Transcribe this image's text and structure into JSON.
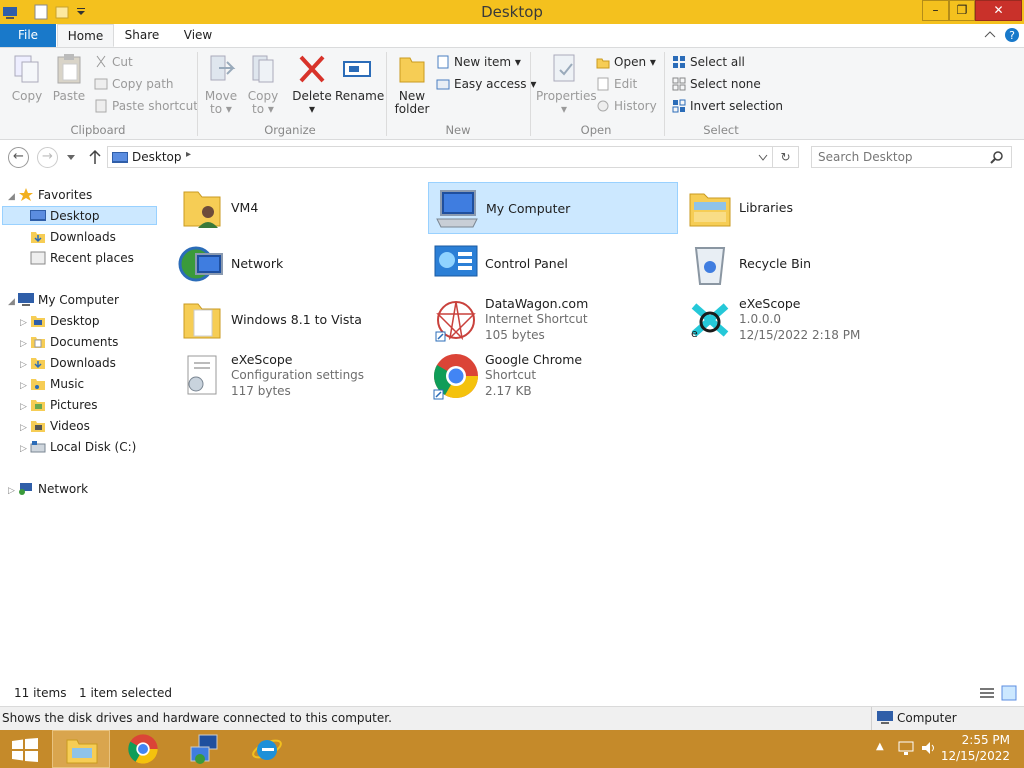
{
  "window": {
    "title": "Desktop"
  },
  "tabs": {
    "file": "File",
    "home": "Home",
    "share": "Share",
    "view": "View"
  },
  "ribbon": {
    "clipboard": {
      "label": "Clipboard",
      "copy": "Copy",
      "paste": "Paste",
      "cut": "Cut",
      "copy_path": "Copy path",
      "paste_shortcut": "Paste shortcut"
    },
    "organize": {
      "label": "Organize",
      "move_to_1": "Move",
      "move_to_2": "to",
      "copy_to_1": "Copy",
      "copy_to_2": "to",
      "delete": "Delete",
      "rename": "Rename"
    },
    "new": {
      "label": "New",
      "new_folder_1": "New",
      "new_folder_2": "folder",
      "new_item": "New item",
      "easy_access": "Easy access"
    },
    "open": {
      "label": "Open",
      "properties": "Properties",
      "open": "Open",
      "edit": "Edit",
      "history": "History"
    },
    "select": {
      "label": "Select",
      "select_all": "Select all",
      "select_none": "Select none",
      "invert_selection": "Invert selection"
    }
  },
  "address": {
    "path": "Desktop",
    "search_placeholder": "Search Desktop"
  },
  "navpane": {
    "favorites": "Favorites",
    "fav_items": [
      "Desktop",
      "Downloads",
      "Recent places"
    ],
    "my_computer": "My Computer",
    "pc_items": [
      "Desktop",
      "Documents",
      "Downloads",
      "Music",
      "Pictures",
      "Videos",
      "Local Disk (C:)"
    ],
    "network": "Network"
  },
  "items": {
    "vm4": {
      "name": "VM4"
    },
    "my_computer": {
      "name": "My Computer"
    },
    "libraries": {
      "name": "Libraries"
    },
    "network": {
      "name": "Network"
    },
    "control_panel": {
      "name": "Control Panel"
    },
    "recycle_bin": {
      "name": "Recycle Bin"
    },
    "win81": {
      "name": "Windows 8.1 to Vista"
    },
    "datawagon": {
      "name": "DataWagon.com",
      "type": "Internet Shortcut",
      "size": "105 bytes"
    },
    "exescope_app": {
      "name": "eXeScope",
      "version": "1.0.0.0",
      "date": "12/15/2022 2:18 PM"
    },
    "exescope_cfg": {
      "name": "eXeScope",
      "type": "Configuration settings",
      "size": "117 bytes"
    },
    "chrome": {
      "name": "Google Chrome",
      "type": "Shortcut",
      "size": "2.17 KB"
    }
  },
  "status": {
    "count": "11 items",
    "selected": "1 item selected"
  },
  "infobar": {
    "description": "Shows the disk drives and hardware connected to this computer.",
    "location": "Computer"
  },
  "clock": {
    "time": "2:55 PM",
    "date": "12/15/2022"
  },
  "colors": {
    "titlebar": "#f4c11e",
    "taskbar": "#c58a2a",
    "selection": "#cce8ff",
    "file_tab": "#1979ca"
  }
}
